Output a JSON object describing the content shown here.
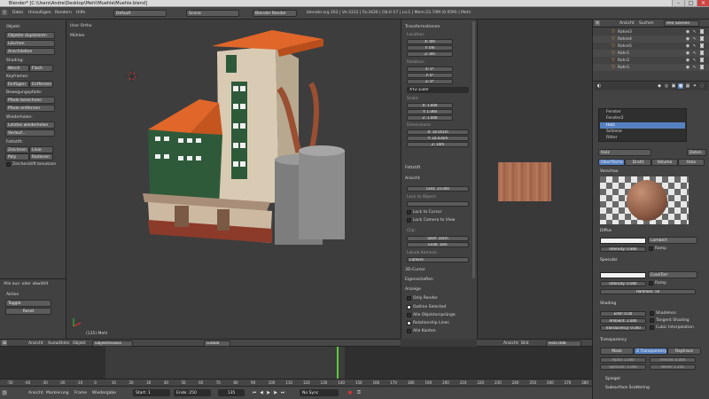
{
  "window": {
    "title": "Blender* [C:\\Users\\Andre\\Desktop\\Mehl\\Muehle\\Muehle.blend]"
  },
  "topbar": {
    "menus": [
      "Datei",
      "Hinzufügen",
      "Rendern",
      "Hilfe"
    ],
    "layout": "Default",
    "scene": "Scene",
    "engine": "Blender Render",
    "stats": "blender.org 262 | Ve:3312 | Fa:3426 | Ob:0-17 | La:1 | Mem:23.74M (0.05M) | Mehl"
  },
  "tool": {
    "object_title": "Objekt:",
    "object_buttons": [
      "Objekte duplizieren",
      "Löschen",
      "Anschließen"
    ],
    "shading_title": "Shading:",
    "shading": [
      "Weich",
      "Flach"
    ],
    "keyframes_title": "Keyframes:",
    "keyframes": [
      "Einfügen",
      "Entfernen"
    ],
    "motion_title": "Bewegungspfade:",
    "motion": [
      "Pfade berechnen",
      "Pfade entfernen"
    ],
    "repeat_title": "Wiederholen:",
    "repeat": [
      "Letztes wiederholen",
      "Verlauf..."
    ],
    "grease_title": "Fettstift:",
    "grease": [
      "Zeichnen",
      "Linie",
      "Poly",
      "Radieren"
    ],
    "grease_check": "Zeichenstift benutzen",
    "op_title": "Alle aus- oder abwählt",
    "op_action_label": "Aktion",
    "op_action": "Toggle",
    "op_reset": "Reset"
  },
  "view3d": {
    "view_label": "User Ortho",
    "obj_label": "Mühlen",
    "footer": "(135) Mehl",
    "header": {
      "menus": [
        "Ansicht",
        "Auswählen",
        "Objekt"
      ],
      "mode": "Objektmodus",
      "pivot": "Global"
    }
  },
  "props": {
    "transform": "Transformationen",
    "location": "Location:",
    "loc": [
      "X: 0m",
      "Y: 0m",
      "Z: 0m"
    ],
    "rotation": "Rotation:",
    "rot": [
      "X: 0°",
      "Y: 0°",
      "Z: 0°"
    ],
    "rot_mode": "XYZ Euler",
    "scale": "Scale:",
    "scl": [
      "X: 1.000",
      "Y: 1.000",
      "Z: 1.000"
    ],
    "dimensions": "Dimensions:",
    "dim": [
      "X: 14.051m",
      "Y: 10.435m",
      "Z: 14m"
    ],
    "grease": "Fettstift",
    "view": "Ansicht",
    "lens": "Lens: 35.000",
    "lock": "Lock to Object:",
    "lock_cursor": "Lock to Cursor",
    "lock_camera": "Lock Camera to View",
    "clip": "Clip:",
    "clip_start": "Start: 10cm",
    "clip_end": "Ende: 1km",
    "local_camera": "Lokale Kamera:",
    "camera": "Camera",
    "cursor3d": "3D-Cursor",
    "objects": "Eigenschaften",
    "display": "Anzeige",
    "only_render": "Only Render",
    "outline": "Outline Selected",
    "all_origins": "Alle Objektursprünge",
    "relationship": "Relationship Lines",
    "all_edges": "Alle Kanten"
  },
  "uv": {
    "header": [
      "Ansicht",
      "Bild"
    ],
    "image": "Holz.ddb"
  },
  "outliner": {
    "header": [
      "Ansicht",
      "Suchen",
      "Alle Szenen"
    ],
    "items": [
      "Rohre3",
      "Rohre4",
      "Rohre5",
      "Rohr1",
      "Rohr2",
      "Rohr1"
    ]
  },
  "material": {
    "slots": [
      "Fenster",
      "Fenster2",
      "Holz",
      "Schiene",
      "Ritter"
    ],
    "active": "Holz",
    "data": "Daten",
    "tabs": [
      "Oberfläche",
      "Draht",
      "Volume",
      "Halo"
    ],
    "preview": "Vorschau",
    "diffuse": "Diffus",
    "diffuse_shader": "Lambert",
    "diffuse_int": "Intensity: 0.800",
    "ramp": "Ramp",
    "specular": "Specular",
    "spec_shader": "CookTorr",
    "spec_int": "Intensity: 0.000",
    "hardness": "Hardness: 50",
    "shading": "Shading",
    "emit": "Emit: 0.00",
    "ambient": "Ambient: 1.000",
    "translucency": "Translucency: 0.000",
    "shadeless": "Shadeless",
    "tangent": "Tangent Shading",
    "cubic": "Cubic Interpolation",
    "transparency": "Transparency",
    "tr_modes": [
      "Mask",
      "Z Transparency",
      "Raytrace"
    ],
    "alpha": "Alpha: 1.000",
    "fresnel": "Fresnel: 0.000",
    "specular_f": "Specular: 1.000",
    "blend": "Blend: 1.250",
    "mirror": "Spiegel",
    "sss": "Subsurface Scattering"
  },
  "timeline": {
    "ticks": [
      "-50",
      "-40",
      "-30",
      "-20",
      "-10",
      "0",
      "10",
      "20",
      "30",
      "40",
      "50",
      "60",
      "70",
      "80",
      "90",
      "100",
      "110",
      "120",
      "130",
      "140",
      "150",
      "160",
      "170",
      "180",
      "190",
      "200",
      "210",
      "220",
      "230",
      "240",
      "250",
      "260",
      "270",
      "280"
    ],
    "menus": [
      "Ansicht",
      "Markierung",
      "Frame",
      "Wiedergabe"
    ],
    "start": "Start: 1",
    "end": "Ende: 250",
    "current": "135",
    "sync": "No Sync"
  },
  "colors": {
    "accent": "#5680c2",
    "timeline_cursor": "#5ecb3c",
    "roof": "#e0662a",
    "wall": "#d9cbb3",
    "green": "#2f5a3a"
  }
}
